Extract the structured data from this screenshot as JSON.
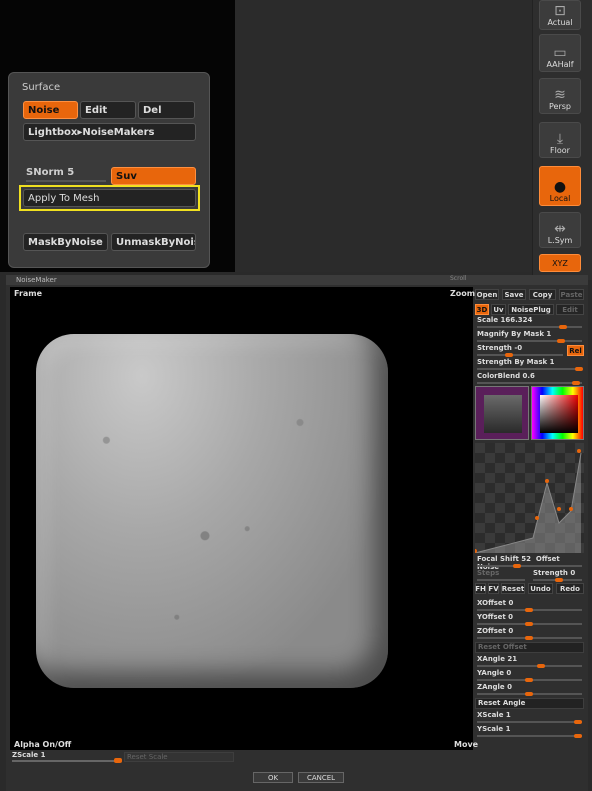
{
  "surface": {
    "title": "Surface",
    "noise_label": "Noise",
    "edit_label": "Edit",
    "del_label": "Del",
    "lightbox_label": "Lightbox▸NoiseMakers",
    "snorm_label": "SNorm 5",
    "suv_label": "Suv",
    "apply_label": "Apply To Mesh",
    "maskbynoise_label": "MaskByNoise",
    "unmaskbynoise_label": "UnmaskByNois"
  },
  "tools": {
    "actual": "Actual",
    "aahalf": "AAHalf",
    "persp": "Persp",
    "floor": "Floor",
    "local": "Local",
    "lsym": "L.Sym",
    "xyz": "XYZ"
  },
  "noisemaker": {
    "title": "NoiseMaker",
    "scroll_label": "Scroll",
    "frame_label": "Frame",
    "zoom_label": "Zoom",
    "alpha_label": "Alpha On/Off",
    "move_label": "Move",
    "zscale_label": "ZScale 1",
    "reset_scale_label": "Reset Scale",
    "ok_label": "OK",
    "cancel_label": "CANCEL"
  },
  "params": {
    "open": "Open",
    "save": "Save",
    "copy": "Copy",
    "paste": "Paste",
    "mode_3d": "3D",
    "mode_uv": "Uv",
    "noiseplug": "NoisePlug",
    "edit": "Edit",
    "scale": "Scale 166.324",
    "magnify": "Magnify By Mask 1",
    "strength": "Strength -0",
    "rel": "Rel",
    "strength_mask": "Strength By Mask 1",
    "colorblend": "ColorBlend 0.6",
    "focal_shift": "Focal Shift 52",
    "offset": "Offset",
    "noise": "Noise",
    "steps": "Steps",
    "strength_curve": "Strength 0",
    "fh": "FH",
    "fv": "FV",
    "reset": "Reset",
    "undo": "Undo",
    "redo": "Redo",
    "xoffset": "XOffset 0",
    "yoffset": "YOffset 0",
    "zoffset": "ZOffset 0",
    "reset_offset": "Reset Offset",
    "xangle": "XAngle 21",
    "yangle": "YAngle 0",
    "zangle": "ZAngle 0",
    "reset_angle": "Reset Angle",
    "xscale": "XScale 1",
    "yscale": "YScale 1"
  },
  "colors": {
    "accent": "#e8660c",
    "highlight": "#f0e020"
  }
}
